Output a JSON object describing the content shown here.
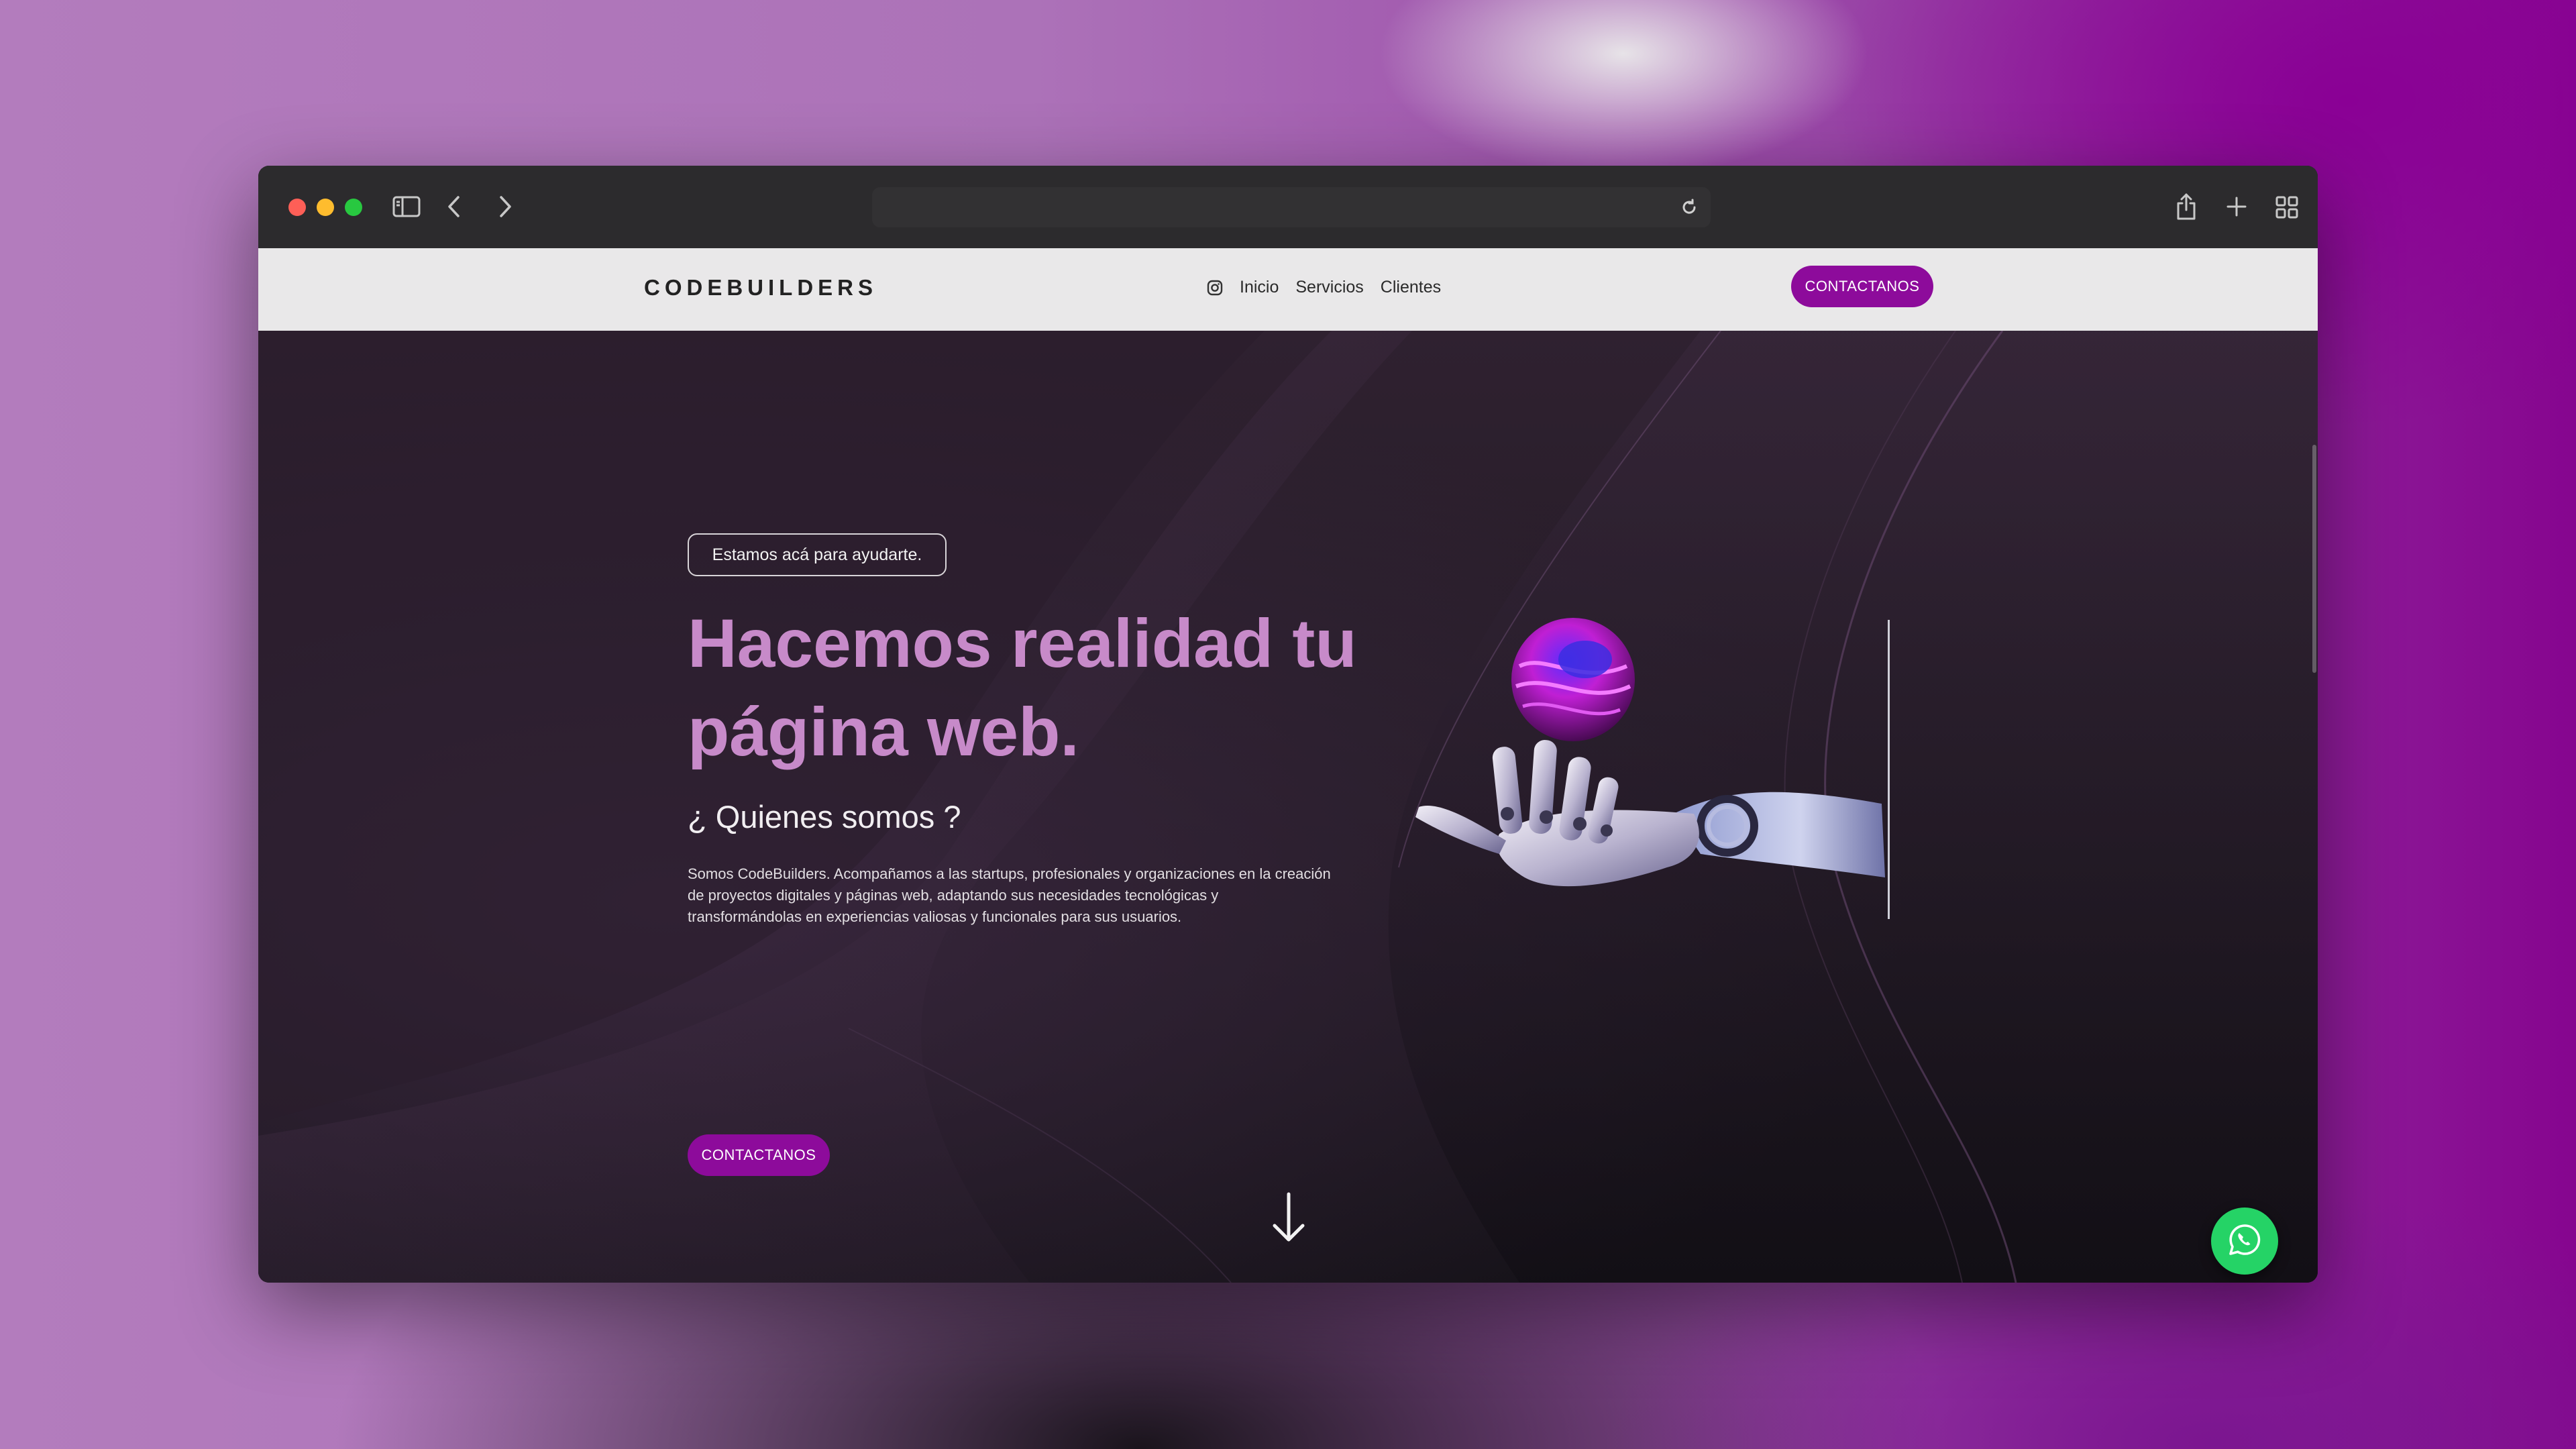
{
  "site": {
    "brand": "CODEBUILDERS",
    "nav": {
      "links": [
        "Inicio",
        "Servicios",
        "Clientes"
      ],
      "cta_label": "CONTACTANOS"
    }
  },
  "hero": {
    "badge": "Estamos acá para ayudarte.",
    "headline_line1": "Hacemos realidad tu",
    "headline_line2": "página web.",
    "subtitle": "¿ Quienes somos ?",
    "description": "Somos CodeBuilders. Acompañamos a las startups, profesionales y organizaciones en la creación de proyectos digitales y páginas web, adaptando sus necesidades tecnológicas y transformándolas en experiencias valiosas y funcionales para sus usuarios.",
    "cta_label": "CONTACTANOS"
  },
  "icons": {
    "instagram": "instagram-icon",
    "whatsapp": "whatsapp-icon",
    "scroll": "arrow-down-icon",
    "sidebar": "sidebar-icon",
    "back": "chevron-left-icon",
    "forward": "chevron-right-icon",
    "reload": "reload-icon",
    "share": "share-icon",
    "new_tab": "plus-icon",
    "tabs_overview": "tab-grid-icon"
  },
  "colors": {
    "brand_purple": "#8d0b9b",
    "headline": "#c78ac9",
    "whatsapp_green": "#25d366"
  }
}
